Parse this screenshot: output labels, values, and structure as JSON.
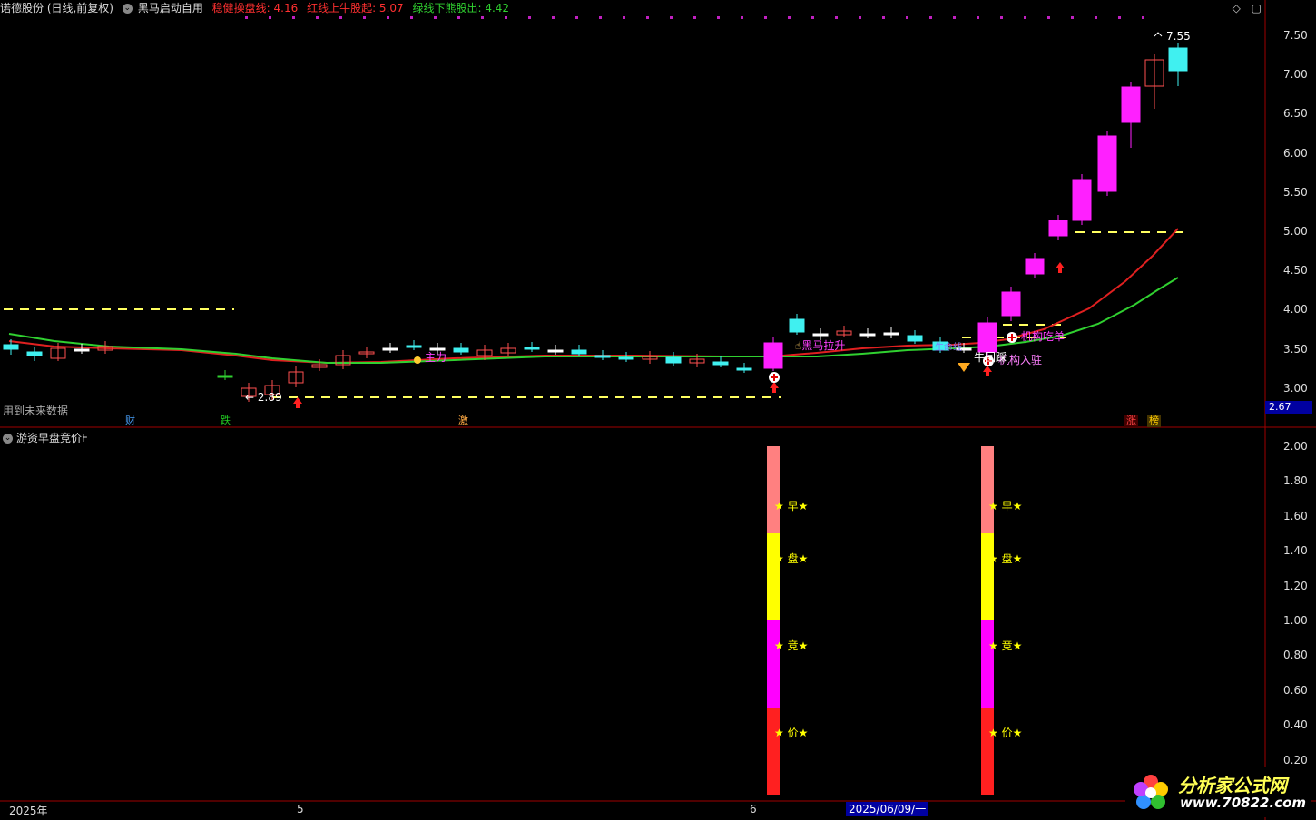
{
  "header": {
    "stock_title": "诺德股份 (日线,前复权)",
    "indicator_name": "黑马启动自用",
    "line1": "稳健操盘线: 4.16",
    "line2": "红线上牛股起: 5.07",
    "line3": "绿线下熊股出: 4.42"
  },
  "top_icons": {
    "diamond": "◇",
    "window": "▢"
  },
  "price_axis": [
    "7.50",
    "7.00",
    "6.50",
    "6.00",
    "5.50",
    "5.00",
    "4.50",
    "4.00",
    "3.50",
    "3.00"
  ],
  "price_tag": "2.67",
  "future_note": "用到未来数据",
  "markers": [
    {
      "text": "财",
      "color": "#4aa3ff"
    },
    {
      "text": "跌",
      "color": "#22cc22"
    },
    {
      "text": "激",
      "color": "#ffaa44"
    },
    {
      "text": "涨",
      "color": "#ff4444"
    },
    {
      "text": "榜",
      "color": "#ffcc00"
    }
  ],
  "annotations": {
    "low_label": "← 2.89",
    "high_label": "7.55",
    "heima": "黑马拉升",
    "jigou_chibi": "机构吃单",
    "jigou_ruchang": "机构入驻",
    "zhuli": "主力",
    "niu_hui": "牛回踩",
    "dibu": "生命线"
  },
  "sub_chart": {
    "title": "游资早盘竞价F",
    "axis": [
      "2.00",
      "1.80",
      "1.60",
      "1.40",
      "1.20",
      "1.00",
      "0.80",
      "0.60",
      "0.40",
      "0.20"
    ],
    "bar_labels": [
      "★ 早★",
      "★ 盘★",
      "★ 竞★",
      "★ 价★"
    ],
    "bar_colors": [
      "#ff8080",
      "#ffff00",
      "#ff00ff",
      "#ff2020"
    ]
  },
  "x_axis": {
    "year": "2025年",
    "may": "5",
    "june": "6",
    "cursor_date": "2025/06/09/一"
  },
  "logo": {
    "name": "分析家公式网",
    "url": "www.70822.com"
  },
  "colors": {
    "up": "#ff5050",
    "down": "#40f0f0",
    "hot": "#ff20ff",
    "red_line": "#e02020",
    "green_line": "#30d030",
    "dash": "#ffff60"
  }
}
